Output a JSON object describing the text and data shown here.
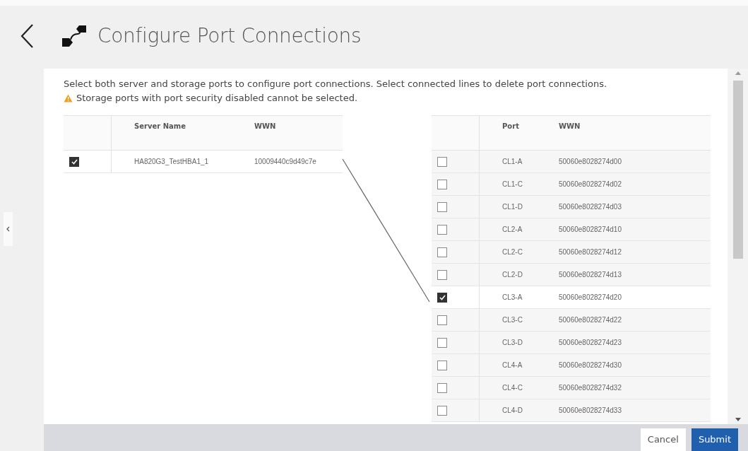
{
  "page": {
    "title": "Configure Port Connections"
  },
  "instructions": "Select both server and storage ports to configure port connections. Select connected lines to delete port connections.",
  "warning": "Storage ports with port security disabled cannot be selected.",
  "server_table": {
    "columns": [
      "Server Name",
      "WWN"
    ],
    "rows": [
      {
        "name": "HA820G3_TestHBA1_1",
        "wwn": "10009440c9d49c7e",
        "selected": true
      }
    ]
  },
  "storage_table": {
    "columns": [
      "Port",
      "WWN"
    ],
    "rows": [
      {
        "port": "CL1-A",
        "wwn": "50060e8028274d00",
        "selected": false
      },
      {
        "port": "CL1-C",
        "wwn": "50060e8028274d02",
        "selected": false
      },
      {
        "port": "CL1-D",
        "wwn": "50060e8028274d03",
        "selected": false
      },
      {
        "port": "CL2-A",
        "wwn": "50060e8028274d10",
        "selected": false
      },
      {
        "port": "CL2-C",
        "wwn": "50060e8028274d12",
        "selected": false
      },
      {
        "port": "CL2-D",
        "wwn": "50060e8028274d13",
        "selected": false
      },
      {
        "port": "CL3-A",
        "wwn": "50060e8028274d20",
        "selected": true
      },
      {
        "port": "CL3-C",
        "wwn": "50060e8028274d22",
        "selected": false
      },
      {
        "port": "CL3-D",
        "wwn": "50060e8028274d23",
        "selected": false
      },
      {
        "port": "CL4-A",
        "wwn": "50060e8028274d30",
        "selected": false
      },
      {
        "port": "CL4-C",
        "wwn": "50060e8028274d32",
        "selected": false
      },
      {
        "port": "CL4-D",
        "wwn": "50060e8028274d33",
        "selected": false
      }
    ]
  },
  "buttons": [
    {
      "label": "Cancel",
      "kind": "secondary"
    },
    {
      "label": "Submit",
      "kind": "primary"
    }
  ]
}
